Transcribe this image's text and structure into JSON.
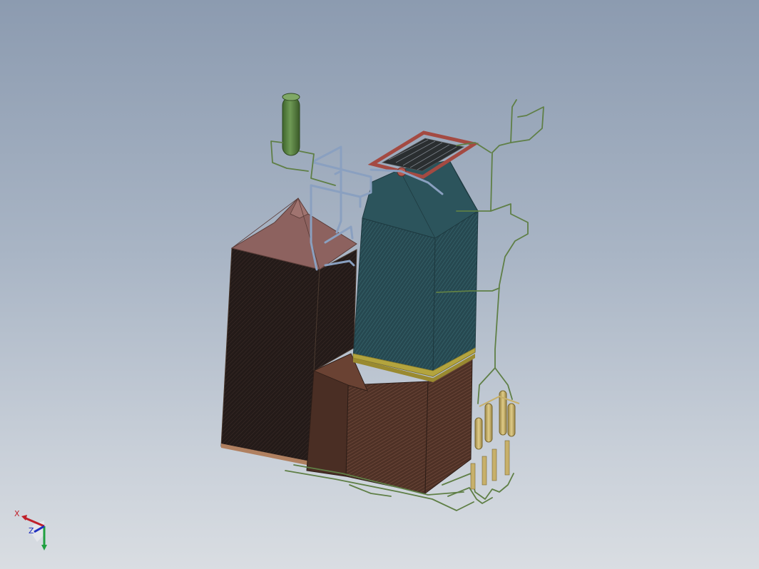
{
  "viewport": {
    "background_top": "#8c9bb0",
    "background_bottom": "#d9dde2"
  },
  "model": {
    "components": [
      "steam-drum",
      "furnace-tower",
      "convection-tower",
      "lower-hopper",
      "top-roof-frame",
      "riser-pipe-network",
      "downcomer-pipe-network",
      "header-cylinders",
      "bottom-manifold"
    ],
    "colors": {
      "drum": "#4f7a3a",
      "furnace_roof": "#8a5f5c",
      "furnace_body": "#2a1f1d",
      "convection_body": "#2c4f57",
      "lower_body": "#5a3a2c",
      "roof_frame": "#a44a42",
      "pipes_blue": "#8aa0c0",
      "pipes_green": "#5f7f46",
      "headers": "#c7b06a",
      "band": "#b0a040"
    }
  },
  "triad": {
    "x_label": "X",
    "z_label": "Z",
    "x_color": "#c0202a",
    "y_color": "#20a040",
    "z_color": "#2030c0"
  }
}
